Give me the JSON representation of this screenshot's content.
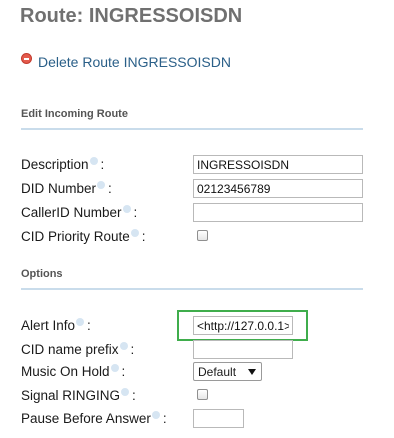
{
  "page": {
    "title": "Route: INGRESSOISDN"
  },
  "actions": {
    "delete_label": "Delete Route INGRESSOISDN",
    "delete_icon": "minus-circle-icon",
    "delete_color": "#e45a4c",
    "link_color": "#2a5f88"
  },
  "edit_section": {
    "heading": "Edit Incoming Route",
    "fields": {
      "description": {
        "label": "Description",
        "value": "INGRESSOISDN"
      },
      "did_number": {
        "label": "DID Number",
        "value": "02123456789"
      },
      "callerid_number": {
        "label": "CallerID Number",
        "value": ""
      },
      "cid_priority_route": {
        "label": "CID Priority Route",
        "checked": false
      }
    }
  },
  "options_section": {
    "heading": "Options",
    "fields": {
      "alert_info": {
        "label": "Alert Info",
        "value": "<http://127.0.0.1>"
      },
      "cid_name_prefix": {
        "label": "CID name prefix",
        "value": ""
      },
      "music_on_hold": {
        "label": "Music On Hold",
        "selected": "Default"
      },
      "signal_ringing": {
        "label": "Signal RINGING",
        "checked": false
      },
      "pause_before_answer": {
        "label": "Pause Before Answer",
        "value": ""
      }
    }
  },
  "label_suffix": ":",
  "highlight_color": "#3fad4c"
}
